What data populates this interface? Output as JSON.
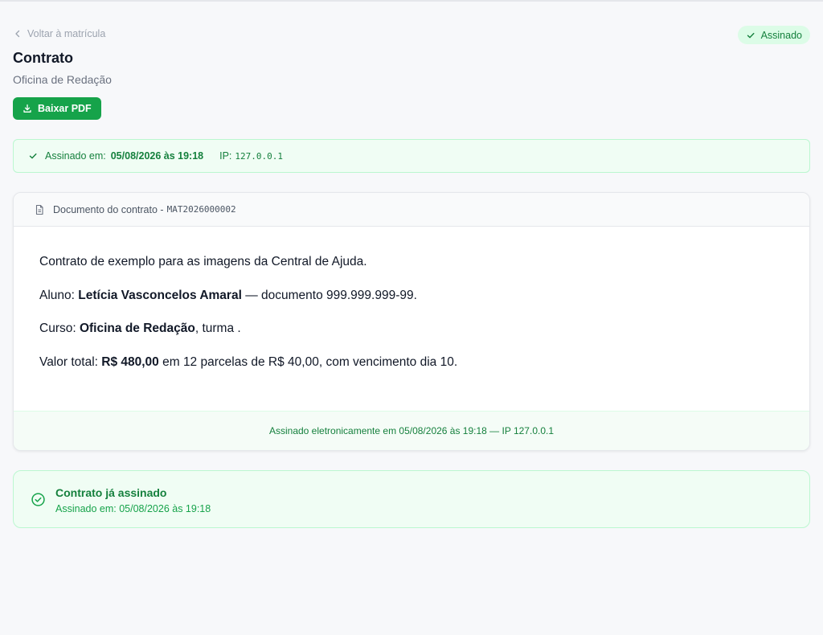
{
  "nav": {
    "back_label": "Voltar à matrícula"
  },
  "status": {
    "label": "Assinado",
    "color": "#15803d",
    "background": "#dcfce7"
  },
  "header": {
    "title": "Contrato",
    "subtitle": "Oficina de Redação"
  },
  "actions": {
    "download_label": "Baixar PDF",
    "download_color": "#16a34a"
  },
  "signed_bar": {
    "label": "Assinado em:",
    "datetime": "05/08/2026 às 19:18",
    "ip_label": "IP:",
    "ip_value": "127.0.0.1"
  },
  "document": {
    "header_label": "Documento do contrato -",
    "code": "MAT2026000002",
    "paragraphs": {
      "intro": "Contrato de exemplo para as imagens da Central de Ajuda.",
      "student_label": "Aluno:",
      "student_name": "Letícia Vasconcelos Amaral",
      "student_suffix": " — documento 999.999.999-99.",
      "course_label": "Curso:",
      "course_name": "Oficina de Redação",
      "course_suffix": ", turma .",
      "value_label": "Valor total:",
      "value_amount": "R$ 480,00",
      "value_suffix": " em 12 parcelas de R$ 40,00, com vencimento dia 10."
    },
    "footer": "Assinado eletronicamente em 05/08/2026 às 19:18 — IP 127.0.0.1"
  },
  "signed_notice": {
    "title": "Contrato já assinado",
    "detail": "Assinado em: 05/08/2026 às 19:18"
  },
  "icons": {
    "back": "chevron-left-icon",
    "status": "check-icon",
    "download": "download-icon",
    "signed": "check-icon",
    "document": "file-text-icon",
    "notice": "circle-check-icon"
  }
}
